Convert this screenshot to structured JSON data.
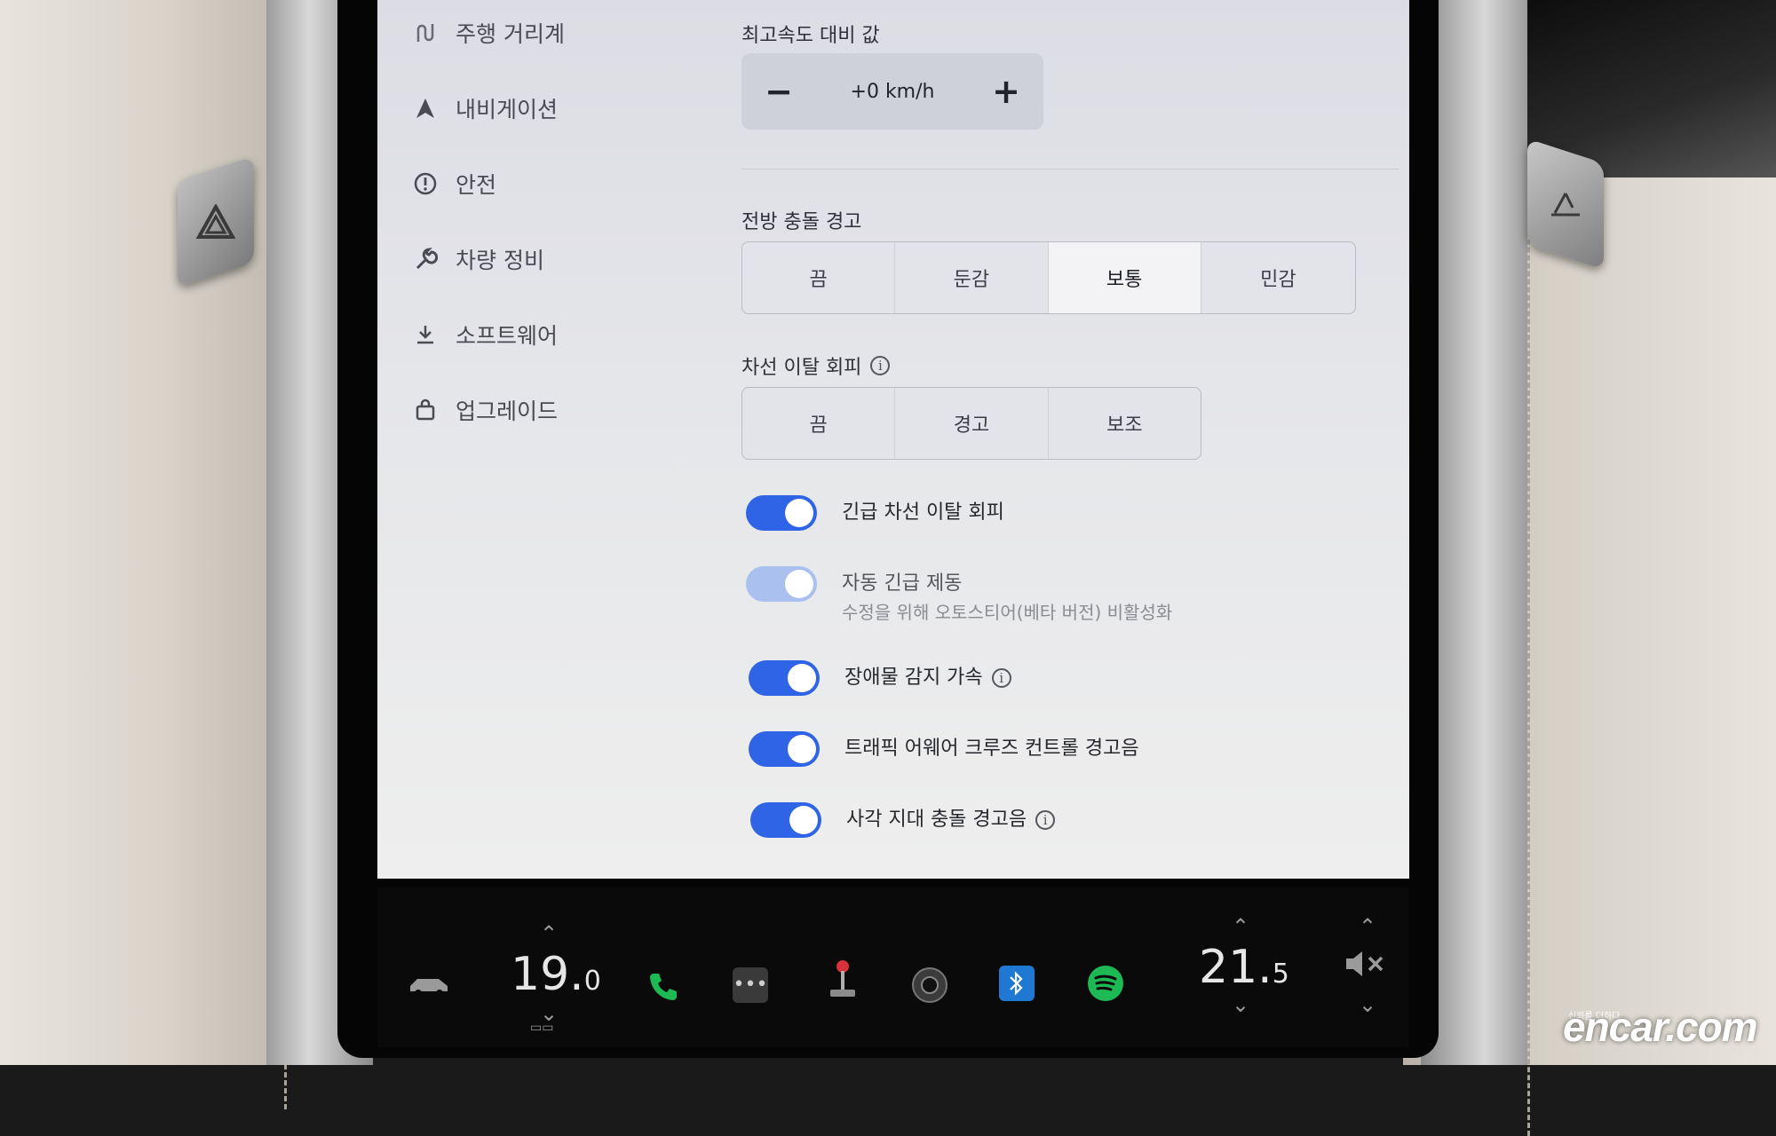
{
  "sidebar": {
    "items": [
      {
        "label": "주행 거리계",
        "icon": "odometer-icon"
      },
      {
        "label": "내비게이션",
        "icon": "navigation-arrow-icon"
      },
      {
        "label": "안전",
        "icon": "safety-info-icon"
      },
      {
        "label": "차량 정비",
        "icon": "wrench-icon"
      },
      {
        "label": "소프트웨어",
        "icon": "download-icon"
      },
      {
        "label": "업그레이드",
        "icon": "shopping-bag-icon"
      }
    ]
  },
  "speed_offset": {
    "title": "최고속도 대비 값",
    "value": "+0 km/h",
    "minus": "−",
    "plus": "+"
  },
  "forward_collision": {
    "title": "전방 충돌 경고",
    "options": [
      "끔",
      "둔감",
      "보통",
      "민감"
    ],
    "selected": "보통"
  },
  "lane_departure": {
    "title": "차선 이탈 회피",
    "options": [
      "끔",
      "경고",
      "보조"
    ],
    "selected": null
  },
  "toggles": [
    {
      "label": "긴급 차선 이탈 회피",
      "on": true,
      "info": false
    },
    {
      "label": "자동 긴급 제동",
      "sub": "수정을 위해 오토스티어(베타 버전) 비활성화",
      "on": true,
      "disabled": true,
      "info": false
    },
    {
      "label": "장애물 감지 가속",
      "on": true,
      "info": true
    },
    {
      "label": "트래픽 어웨어 크루즈 컨트롤 경고음",
      "on": true,
      "info": false
    },
    {
      "label": "사각 지대 충돌 경고음",
      "on": true,
      "info": true
    }
  ],
  "bottom_bar": {
    "driver_temp": "19.",
    "driver_temp_decimal": "0",
    "passenger_temp": "21.",
    "passenger_temp_decimal": "5"
  },
  "watermark": {
    "tag": "신뢰를 더하다",
    "brand": "encar.com"
  },
  "colors": {
    "toggle_on": "#2f64e6",
    "phone_green": "#1db954",
    "bluetooth_blue": "#1f78d1",
    "spotify_green": "#1db954"
  }
}
